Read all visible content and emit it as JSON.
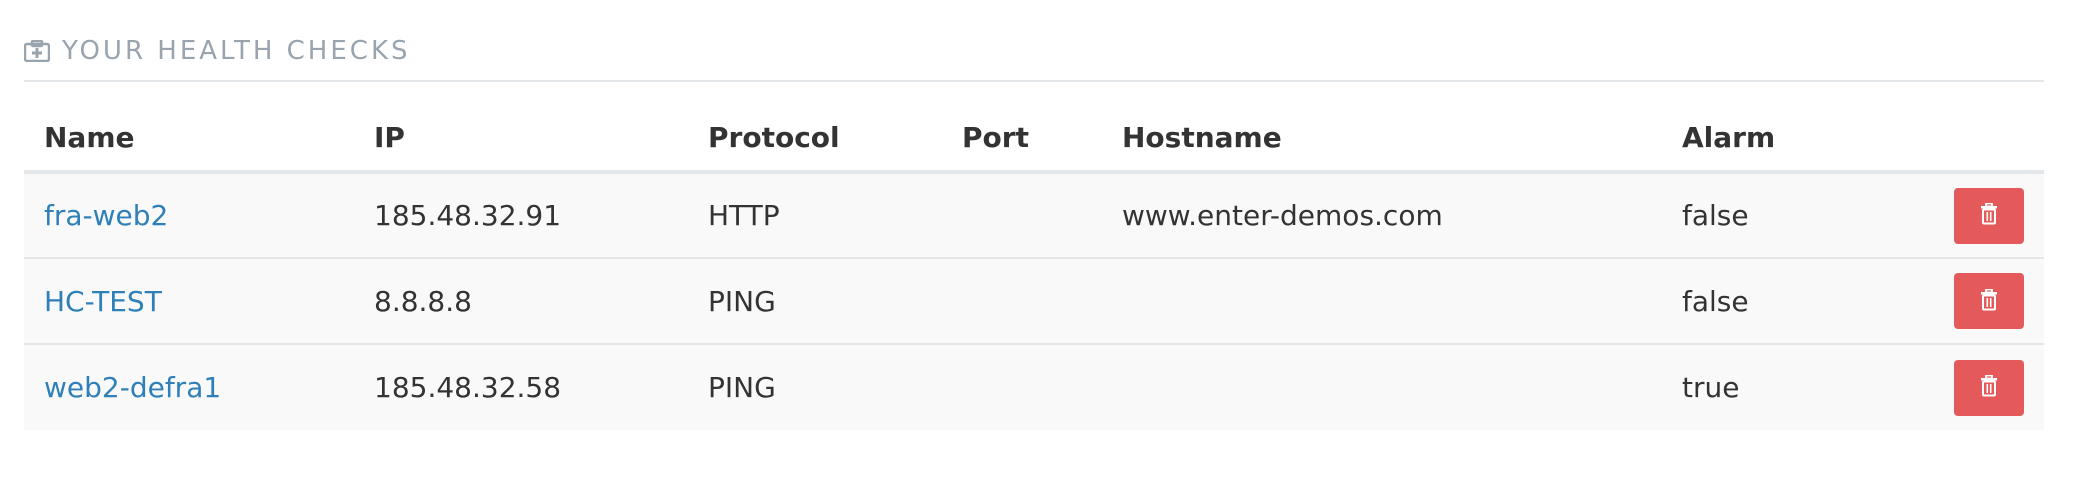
{
  "panel": {
    "title": "YOUR HEALTH CHECKS",
    "icon": "medkit-icon"
  },
  "table": {
    "columns": [
      "Name",
      "IP",
      "Protocol",
      "Port",
      "Hostname",
      "Alarm"
    ],
    "rows": [
      {
        "name": "fra-web2",
        "ip": "185.48.32.91",
        "protocol": "HTTP",
        "port": "",
        "hostname": "www.enter-demos.com",
        "alarm": "false"
      },
      {
        "name": "HC-TEST",
        "ip": "8.8.8.8",
        "protocol": "PING",
        "port": "",
        "hostname": "",
        "alarm": "false"
      },
      {
        "name": "web2-defra1",
        "ip": "185.48.32.58",
        "protocol": "PING",
        "port": "",
        "hostname": "",
        "alarm": "true"
      }
    ],
    "delete_icon": "trash-icon"
  },
  "colors": {
    "heading_text": "#9aa4ae",
    "link": "#2f80b8",
    "danger": "#e45a5a",
    "row_bg": "#f9f9f9",
    "border": "#e4e7ea"
  }
}
